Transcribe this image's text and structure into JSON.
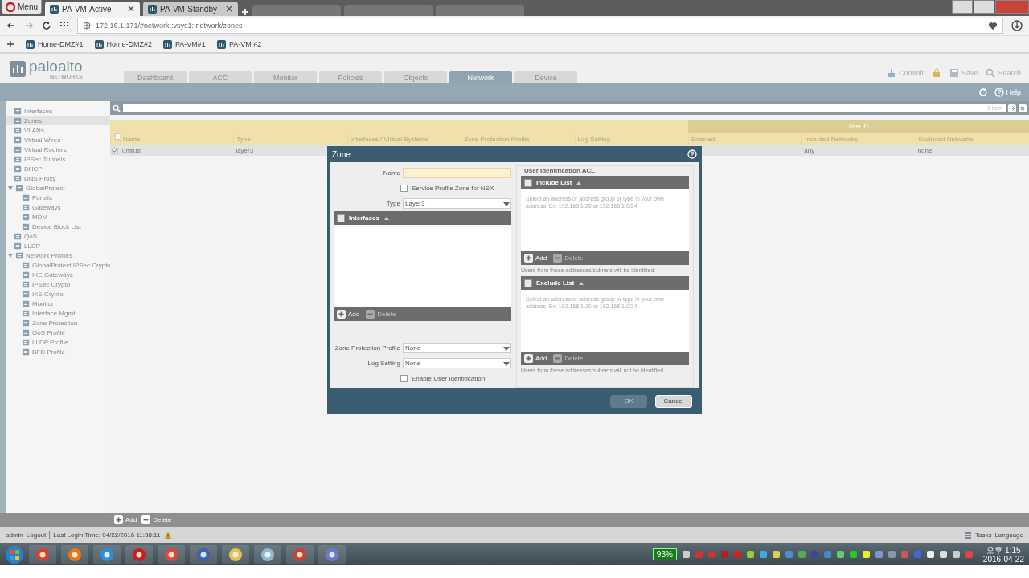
{
  "browser": {
    "menu": "Menu",
    "tabs": [
      {
        "title": "PA-VM-Active",
        "selected": true
      },
      {
        "title": "PA-VM-Standby",
        "selected": false
      }
    ],
    "url": "172.16.1.171/#network::vsys1::network/zones",
    "bookmarks": [
      "Home-DMZ#1",
      "Home-DMZ#2",
      "PA-VM#1",
      "PA-VM #2"
    ]
  },
  "app": {
    "logo": "paloalto",
    "logo_sub": "NETWORKS",
    "tabs": [
      {
        "label": "Dashboard",
        "selected": false
      },
      {
        "label": "ACC",
        "selected": false
      },
      {
        "label": "Monitor",
        "selected": false
      },
      {
        "label": "Policies",
        "selected": false
      },
      {
        "label": "Objects",
        "selected": false
      },
      {
        "label": "Network",
        "selected": true
      },
      {
        "label": "Device",
        "selected": false
      }
    ],
    "actions": {
      "commit": "Commit",
      "save": "Save",
      "search": "Search"
    },
    "help": "Help"
  },
  "sidebar": {
    "items": [
      {
        "label": "Interfaces",
        "selected": false
      },
      {
        "label": "Zones",
        "selected": true
      },
      {
        "label": "VLANs",
        "selected": false
      },
      {
        "label": "Virtual Wires",
        "selected": false
      },
      {
        "label": "Virtual Routers",
        "selected": false
      },
      {
        "label": "IPSec Tunnels",
        "selected": false
      },
      {
        "label": "DHCP",
        "selected": false
      },
      {
        "label": "DNS Proxy",
        "selected": false
      },
      {
        "label": "GlobalProtect",
        "selected": false,
        "expanded": true,
        "children": [
          {
            "label": "Portals",
            "selected": false
          },
          {
            "label": "Gateways",
            "selected": false
          },
          {
            "label": "MDM",
            "selected": false
          },
          {
            "label": "Device Block List",
            "selected": false
          }
        ]
      },
      {
        "label": "QoS",
        "selected": false
      },
      {
        "label": "LLDP",
        "selected": false
      },
      {
        "label": "Network Profiles",
        "selected": false,
        "expanded": true,
        "children": [
          {
            "label": "GlobalProtect IPSec Crypto",
            "selected": false
          },
          {
            "label": "IKE Gateways",
            "selected": false
          },
          {
            "label": "IPSec Crypto",
            "selected": false
          },
          {
            "label": "IKE Crypto",
            "selected": false
          },
          {
            "label": "Monitor",
            "selected": false
          },
          {
            "label": "Interface Mgmt",
            "selected": false
          },
          {
            "label": "Zone Protection",
            "selected": false
          },
          {
            "label": "QoS Profile",
            "selected": false
          },
          {
            "label": "LLDP Profile",
            "selected": false
          },
          {
            "label": "BFD Profile",
            "selected": false
          }
        ]
      }
    ]
  },
  "list": {
    "count": "1 item"
  },
  "table": {
    "group_header": "User ID",
    "select_all_checked": false,
    "columns": [
      "Name",
      "Type",
      "Interfaces / Virtual Systems",
      "Zone Protection Profile",
      "Log Setting",
      "Enabled",
      "Included Networks",
      "Excluded Networks"
    ],
    "rows": [
      {
        "checked": true,
        "name": "untrust",
        "type": "layer3",
        "included_networks": "any",
        "excluded_networks": "none"
      }
    ]
  },
  "footer": {
    "add": "Add",
    "delete": "Delete"
  },
  "status": {
    "user": "admin",
    "logout": "Logout",
    "last_login": "Last Login Time: 04/22/2016 11:38:11",
    "tasks": "Tasks",
    "language": "Language"
  },
  "dialog": {
    "title": "Zone",
    "name_label": "Name",
    "service_profile": {
      "label": "Service Profile Zone for NSX",
      "checked": false
    },
    "type_label": "Type",
    "type_value": "Layer3",
    "interfaces": {
      "header": "Interfaces",
      "select_all_checked": false,
      "add": "Add",
      "delete": "Delete"
    },
    "zone_protection": {
      "label": "Zone Protection Profile",
      "value": "None"
    },
    "log_setting": {
      "label": "Log Setting",
      "value": "None"
    },
    "enable_user_id": {
      "label": "Enable User Identification",
      "checked": false
    },
    "acl_title": "User Identification ACL",
    "acl_lists": [
      {
        "header": "Include List",
        "select_all_checked": false,
        "placeholder": "Select an address or address group or type in your own address. Ex: 192.168.1.20 or 192.168.1.0/24",
        "add": "Add",
        "delete": "Delete",
        "note": "Users from these addresses/subnets will be identified."
      },
      {
        "header": "Exclude List",
        "select_all_checked": false,
        "placeholder": "Select an address or address group or type in your own address. Ex: 192.168.1.20 or 192.168.1.0/24",
        "add": "Add",
        "delete": "Delete",
        "note": "Users from these addresses/subnets will not be identified."
      }
    ],
    "ok": {
      "label": "OK",
      "disabled": true
    },
    "cancel": {
      "label": "Cancel",
      "disabled": false
    }
  },
  "taskbar": {
    "battery": "93%",
    "time": "오후 1:15",
    "date": "2016-04-22"
  }
}
